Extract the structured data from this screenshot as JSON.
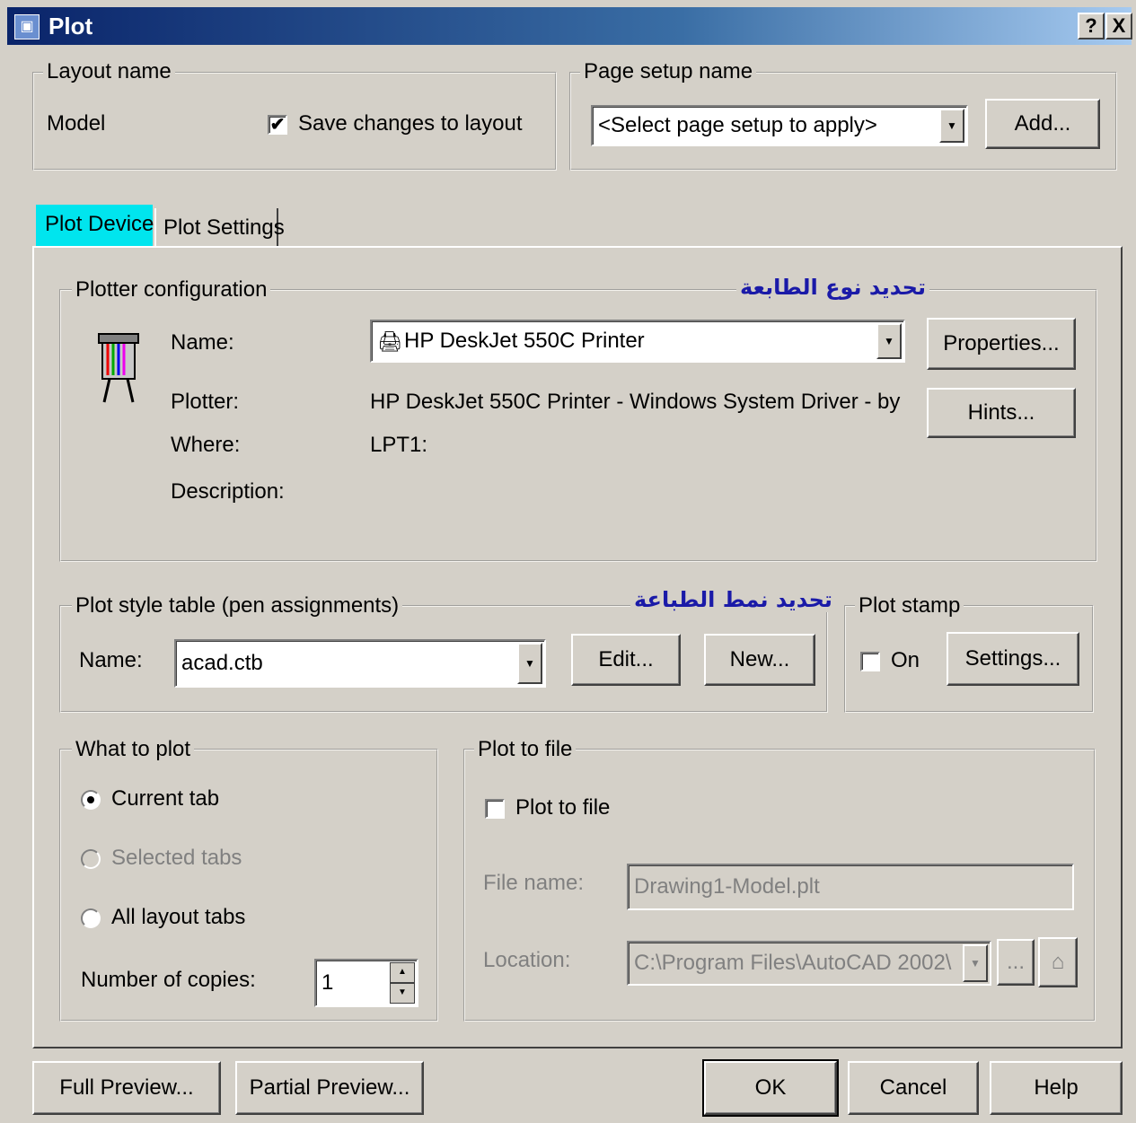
{
  "window": {
    "title": "Plot",
    "help_button": "?",
    "close_button": "X"
  },
  "layout_name": {
    "legend": "Layout name",
    "value": "Model",
    "save_changes_label": "Save changes to layout",
    "save_changes_checked": true
  },
  "page_setup": {
    "legend": "Page setup name",
    "selected": "<Select page setup to apply>",
    "add_label": "Add..."
  },
  "tabs": [
    {
      "label": "Plot Device",
      "active": true
    },
    {
      "label": "Plot Settings",
      "active": false
    }
  ],
  "plotter_config": {
    "legend": "Plotter configuration",
    "annotation": "تحديد نوع الطابعة",
    "name_label": "Name:",
    "name_value": "HP DeskJet 550C Printer",
    "properties_label": "Properties...",
    "plotter_label": "Plotter:",
    "plotter_value": "HP DeskJet 550C Printer - Windows System Driver - by",
    "hints_label": "Hints...",
    "where_label": "Where:",
    "where_value": "LPT1:",
    "description_label": "Description:"
  },
  "plot_style": {
    "legend": "Plot style table (pen assignments)",
    "annotation": "تحديد نمط الطباعة",
    "name_label": "Name:",
    "name_value": "acad.ctb",
    "edit_label": "Edit...",
    "new_label": "New..."
  },
  "plot_stamp": {
    "legend": "Plot stamp",
    "on_label": "On",
    "on_checked": false,
    "settings_label": "Settings..."
  },
  "what_to_plot": {
    "legend": "What to plot",
    "options": [
      {
        "label": "Current tab",
        "selected": true,
        "enabled": true
      },
      {
        "label": "Selected tabs",
        "selected": false,
        "enabled": false
      },
      {
        "label": "All layout tabs",
        "selected": false,
        "enabled": true
      }
    ],
    "copies_label": "Number of copies:",
    "copies_value": "1"
  },
  "plot_to_file": {
    "legend": "Plot to file",
    "checkbox_label": "Plot to file",
    "checked": false,
    "file_name_label": "File name:",
    "file_name_value": "Drawing1-Model.plt",
    "location_label": "Location:",
    "location_value": "C:\\Program Files\\AutoCAD 2002\\",
    "browse_label": "..."
  },
  "footer": {
    "full_preview": "Full Preview...",
    "partial_preview": "Partial Preview...",
    "ok": "OK",
    "cancel": "Cancel",
    "help": "Help"
  },
  "colors": {
    "active_tab_bg": "#00e5ee",
    "annotation_text": "#1a1aa8",
    "title_bar": "#0a246a"
  }
}
